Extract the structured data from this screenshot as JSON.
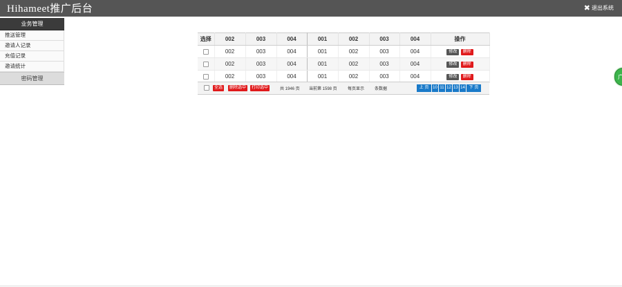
{
  "header": {
    "title": "Hihameet推广后台",
    "logout_label": "退出系统"
  },
  "sidebar": {
    "section_1": "业务管理",
    "items": [
      {
        "label": "推送管理"
      },
      {
        "label": "邀请人记录"
      },
      {
        "label": "充值记录"
      },
      {
        "label": "邀请统计"
      }
    ],
    "section_2": "密码管理"
  },
  "table": {
    "columns": [
      "选择",
      "002",
      "003",
      "004",
      "001",
      "002",
      "003",
      "004",
      "操作"
    ],
    "rows": [
      [
        "002",
        "003",
        "004",
        "001",
        "002",
        "003",
        "004"
      ],
      [
        "002",
        "003",
        "004",
        "001",
        "002",
        "003",
        "004"
      ],
      [
        "002",
        "003",
        "004",
        "001",
        "002",
        "003",
        "004"
      ]
    ],
    "edit_label": "修改",
    "delete_label": "删除"
  },
  "footer": {
    "select_all": "全选",
    "delete_selected": "删除选中",
    "approve_selected": "打印选中",
    "total_text": "共 1946 页",
    "current_page_text": "当前第 1598 页",
    "per_page_text": "每页显示",
    "per_page_unit": "条数据",
    "prev_label": "上 页",
    "page_numbers": [
      "10",
      "11",
      "12",
      "13",
      "14"
    ],
    "next_label": "下 页"
  },
  "float_label": "广"
}
